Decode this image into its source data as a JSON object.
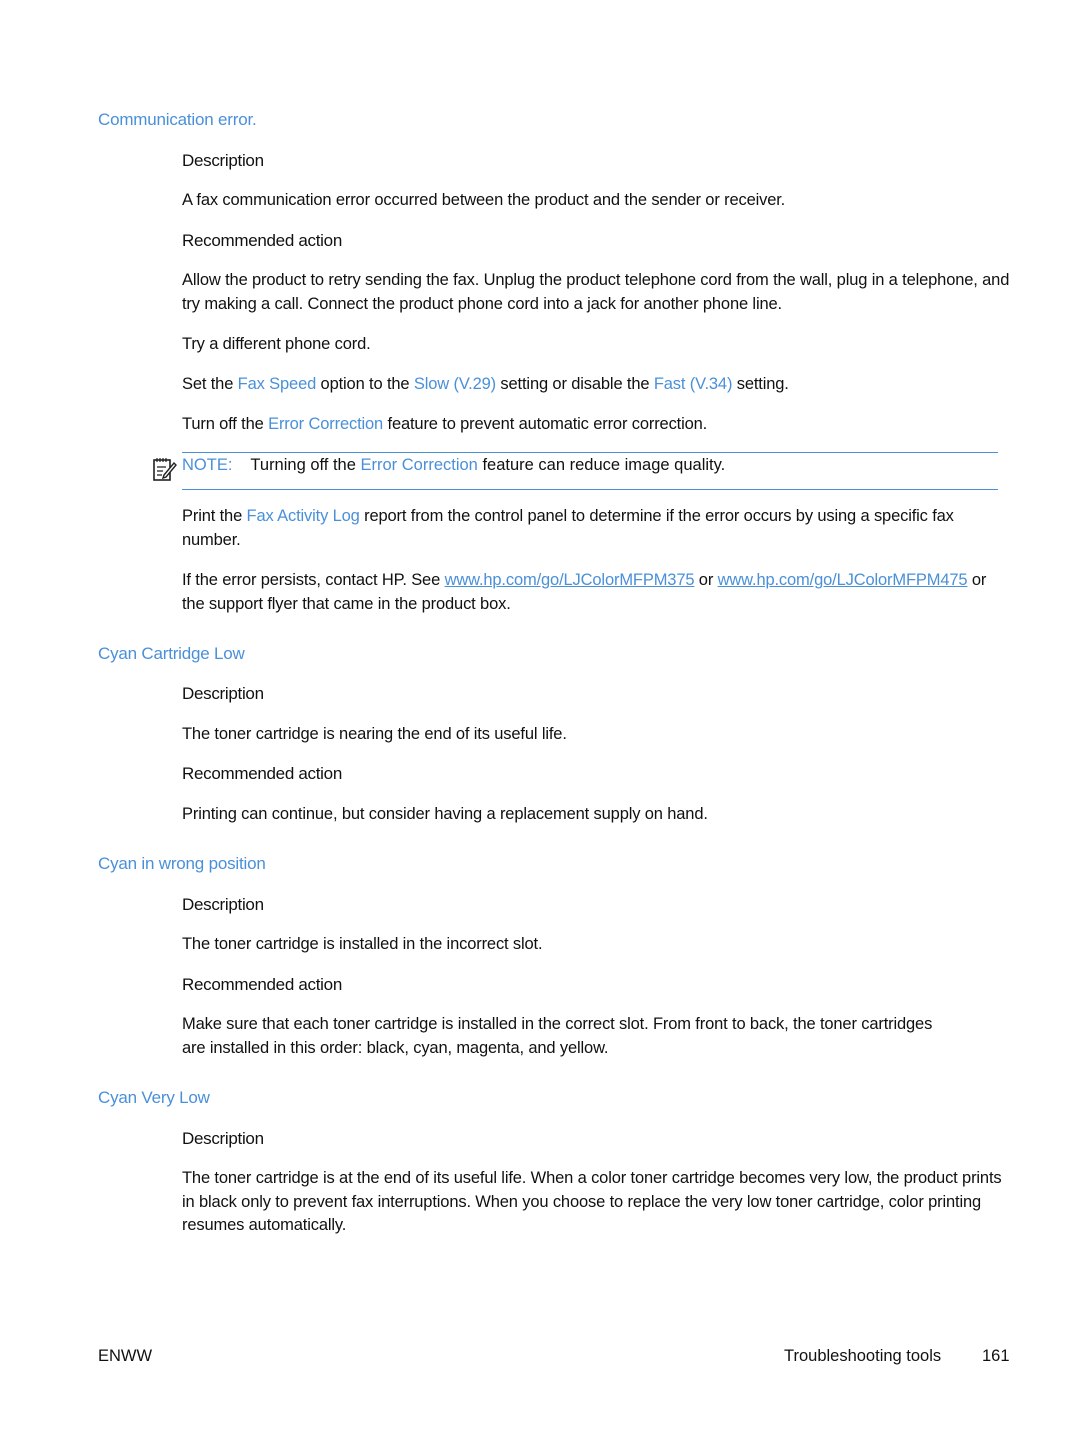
{
  "sections": [
    {
      "heading": "Communication error.",
      "description_label": "Description",
      "description": "A fax communication error occurred between the product and the sender or receiver.",
      "action_label": "Recommended action",
      "actions": {
        "p1": "Allow the product to retry sending the fax. Unplug the product telephone cord from the wall, plug in a telephone, and try making a call. Connect the product phone cord into a jack for another phone line.",
        "p2": "Try a different phone cord.",
        "p3": {
          "t1": "Set the ",
          "l1": "Fax Speed",
          "t2": " option to the ",
          "l2": "Slow (V.29)",
          "t3": " setting or disable the ",
          "l3": "Fast (V.34)",
          "t4": " setting."
        },
        "p4": {
          "t1": "Turn off the ",
          "l1": "Error Correction",
          "t2": " feature to prevent automatic error correction."
        },
        "note": {
          "label": "NOTE:",
          "t1": "Turning off the ",
          "l1": "Error Correction",
          "t2": " feature can reduce image quality."
        },
        "p5": {
          "t1": "Print the ",
          "l1": "Fax Activity Log",
          "t2": " report from the control panel to determine if the error occurs by using a specific fax number."
        },
        "p6": {
          "t1": "If the error persists, contact HP. See ",
          "url1": "www.hp.com/go/LJColorMFPM375",
          "t2": " or ",
          "url2": "www.hp.com/go/LJColorMFPM475",
          "t3": " or the support flyer that came in the product box."
        }
      }
    },
    {
      "heading": "Cyan Cartridge Low",
      "description_label": "Description",
      "description": "The toner cartridge is nearing the end of its useful life.",
      "action_label": "Recommended action",
      "action": "Printing can continue, but consider having a replacement supply on hand."
    },
    {
      "heading": "Cyan in wrong position",
      "description_label": "Description",
      "description": "The toner cartridge is installed in the incorrect slot.",
      "action_label": "Recommended action",
      "action": "Make sure that each toner cartridge is installed in the correct slot. From front to back, the toner cartridges are installed in this order: black, cyan, magenta, and yellow."
    },
    {
      "heading": "Cyan Very Low",
      "description_label": "Description",
      "description": "The toner cartridge is at the end of its useful life. When a color toner cartridge becomes very low, the product prints in black only to prevent fax interruptions. When you choose to replace the very low toner cartridge, color printing resumes automatically."
    }
  ],
  "footer": {
    "left": "ENWW",
    "section": "Troubleshooting tools",
    "page": "161"
  },
  "colors": {
    "accent": "#4a90d9",
    "text": "#111111"
  },
  "icons": {
    "note": "note-pencil-icon"
  }
}
